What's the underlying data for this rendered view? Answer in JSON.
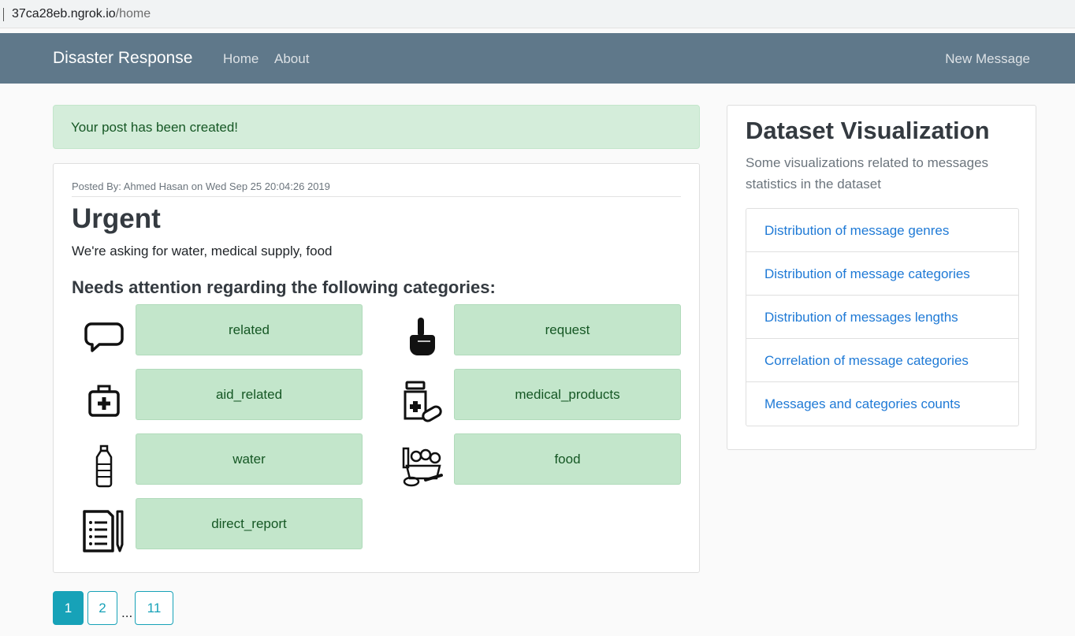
{
  "browser": {
    "url_host": "37ca28eb.ngrok.io",
    "url_path": "/home"
  },
  "navbar": {
    "brand": "Disaster Response",
    "links": [
      "Home",
      "About"
    ],
    "new_message": "New Message"
  },
  "alert": {
    "text": "Your post has been created!"
  },
  "post": {
    "meta": "Posted By: Ahmed Hasan on Wed Sep 25 20:04:26 2019",
    "title": "Urgent",
    "body": "We're asking for water, medical supply, food",
    "subheading": "Needs attention regarding the following categories:",
    "categories": [
      {
        "label": "related",
        "icon": "speech-bubble-icon"
      },
      {
        "label": "request",
        "icon": "raised-finger-icon"
      },
      {
        "label": "aid_related",
        "icon": "first-aid-kit-icon"
      },
      {
        "label": "medical_products",
        "icon": "medicine-bottle-pills-icon"
      },
      {
        "label": "water",
        "icon": "water-bottle-icon"
      },
      {
        "label": "food",
        "icon": "groceries-icon"
      },
      {
        "label": "direct_report",
        "icon": "report-document-pencil-icon"
      }
    ]
  },
  "pagination": {
    "pages": [
      "1",
      "2",
      "11"
    ],
    "ellipsis": "...",
    "active": "1"
  },
  "sidebar": {
    "title": "Dataset Visualization",
    "description": "Some visualizations related to messages statistics in the dataset",
    "links": [
      "Distribution of message genres",
      "Distribution of message categories",
      "Distribution of messages lengths",
      "Correlation of message categories",
      "Messages and categories counts"
    ]
  },
  "colors": {
    "navbar": "#5f788a",
    "alert_bg": "#d4edda",
    "category_bg": "#c3e6cb",
    "category_text": "#155724",
    "pagination_accent": "#17a2b8",
    "link": "#1f7ad6"
  }
}
